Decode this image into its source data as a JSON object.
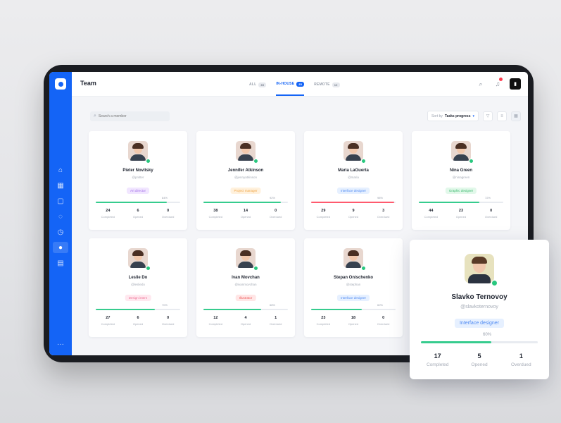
{
  "colors": {
    "accent": "#1464f6",
    "success": "#36cc8e",
    "danger": "#ff5a6e",
    "online": "#28c77e"
  },
  "header": {
    "title": "Team",
    "tabs": [
      {
        "label": "ALL",
        "count": "35"
      },
      {
        "label": "IN-HOUSE",
        "count": "25"
      },
      {
        "label": "REMOTE",
        "count": "10"
      }
    ]
  },
  "search": {
    "placeholder": "Search a member"
  },
  "sort": {
    "prefix": "Sort by",
    "value": "Tasks progress"
  },
  "stat_labels": {
    "completed": "Completed",
    "opened": "Opened",
    "overdued": "Overdued"
  },
  "members": [
    {
      "name": "Pieter Novitsky",
      "handle": "@pnitter",
      "role": "Art director",
      "role_bg": "#f1e6ff",
      "role_fg": "#a16be8",
      "progress": 84,
      "completed": "24",
      "opened": "6",
      "overdued": "0",
      "low": false
    },
    {
      "name": "Jennifer Atkinson",
      "handle": "@jennyatkinson",
      "role": "Project manager",
      "role_bg": "#fff1dd",
      "role_fg": "#f0a545",
      "progress": 92,
      "completed": "38",
      "opened": "14",
      "overdued": "0",
      "low": false
    },
    {
      "name": "Maria LaGuerta",
      "handle": "@maria",
      "role": "Interface designer",
      "role_bg": "#e6f0ff",
      "role_fg": "#4f8af2",
      "progress": 98,
      "completed": "29",
      "opened": "9",
      "overdued": "3",
      "low": true
    },
    {
      "name": "Nina Green",
      "handle": "@ninagreen",
      "role": "Graphic designer",
      "role_bg": "#e2f8ea",
      "role_fg": "#37b86b",
      "progress": 72,
      "completed": "44",
      "opened": "23",
      "overdued": "0",
      "low": false
    },
    {
      "name": "Leslie Do",
      "handle": "@lesliedo",
      "role": "Design intern",
      "role_bg": "#ffe8ef",
      "role_fg": "#ef6f93",
      "progress": 70,
      "completed": "27",
      "opened": "6",
      "overdued": "0",
      "low": false
    },
    {
      "name": "Ivan Movchan",
      "handle": "@ivanmovchan",
      "role": "Illustrator",
      "role_bg": "#ffe6e6",
      "role_fg": "#ef5b5b",
      "progress": 68,
      "completed": "12",
      "opened": "4",
      "overdued": "1",
      "low": false
    },
    {
      "name": "Stepan Onischenko",
      "handle": "@stephan",
      "role": "Interface designer",
      "role_bg": "#e6f0ff",
      "role_fg": "#4f8af2",
      "progress": 60,
      "completed": "23",
      "opened": "18",
      "overdued": "0",
      "low": false
    }
  ],
  "popup": {
    "name": "Slavko Ternovoy",
    "handle": "@slavkoternovoy",
    "role": "Interface designer",
    "progress": 60,
    "completed": "17",
    "opened": "5",
    "overdued": "1"
  },
  "icons": {
    "nav": [
      "home-icon",
      "grid-icon",
      "calendar-icon",
      "chat-icon",
      "clock-icon",
      "team-icon",
      "report-icon"
    ],
    "top": [
      "search-icon",
      "bell-icon",
      "user-icon"
    ]
  }
}
